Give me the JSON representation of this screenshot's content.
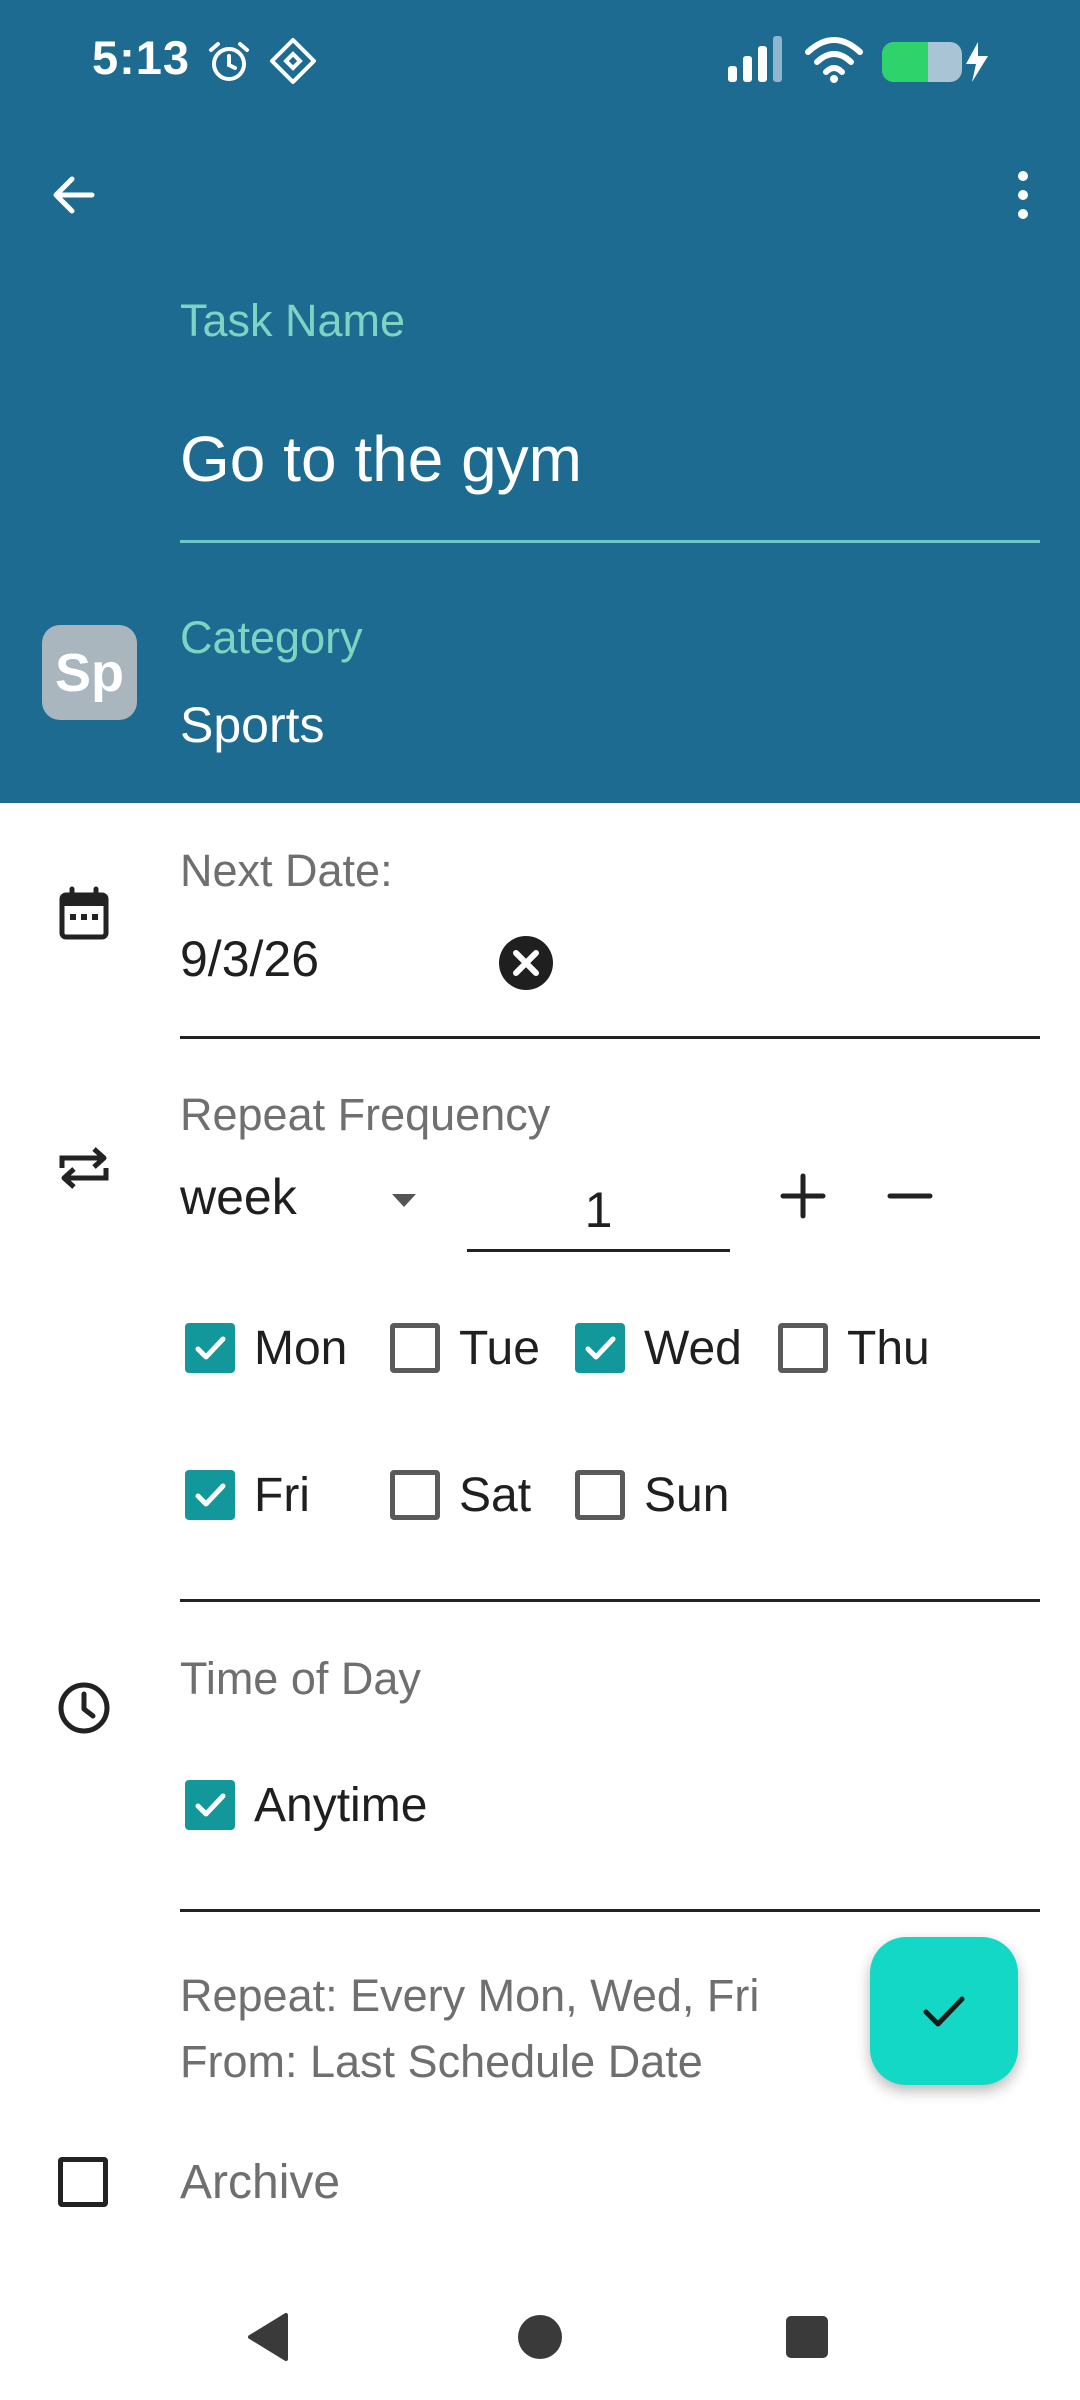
{
  "status_bar": {
    "time": "5:13",
    "icons": [
      "alarm-icon",
      "nfc-icon",
      "signal-icon",
      "wifi-icon",
      "battery-charging-icon"
    ]
  },
  "toolbar": {
    "back_icon": "arrow-left-icon",
    "menu_icon": "more-vert-icon"
  },
  "task": {
    "label": "Task Name",
    "value": "Go to the gym"
  },
  "category": {
    "label": "Category",
    "avatar": "Sp",
    "value": "Sports"
  },
  "next_date": {
    "label": "Next Date:",
    "value": "9/3/26",
    "clear_icon": "close-circle-icon"
  },
  "repeat": {
    "label": "Repeat Frequency",
    "unit": "week",
    "count": "1",
    "increment_icon": "plus-icon",
    "decrement_icon": "minus-icon",
    "days": [
      {
        "label": "Mon",
        "checked": true
      },
      {
        "label": "Tue",
        "checked": false
      },
      {
        "label": "Wed",
        "checked": true
      },
      {
        "label": "Thu",
        "checked": false
      },
      {
        "label": "Fri",
        "checked": true
      },
      {
        "label": "Sat",
        "checked": false
      },
      {
        "label": "Sun",
        "checked": false
      }
    ]
  },
  "time_of_day": {
    "label": "Time of Day",
    "option": "Anytime",
    "checked": true
  },
  "summary": {
    "line1": "Repeat: Every Mon, Wed, Fri",
    "line2": "From: Last Schedule Date"
  },
  "archive": {
    "label": "Archive",
    "checked": false
  },
  "fab": {
    "icon": "check-icon"
  },
  "navbar": {
    "icons": [
      "nav-back-icon",
      "nav-home-icon",
      "nav-recents-icon"
    ]
  },
  "colors": {
    "header_bg": "#1e6b92",
    "accent_label": "#7fd3c3",
    "checkbox_checked": "#12979b",
    "fab_bg": "#12d8c5"
  }
}
